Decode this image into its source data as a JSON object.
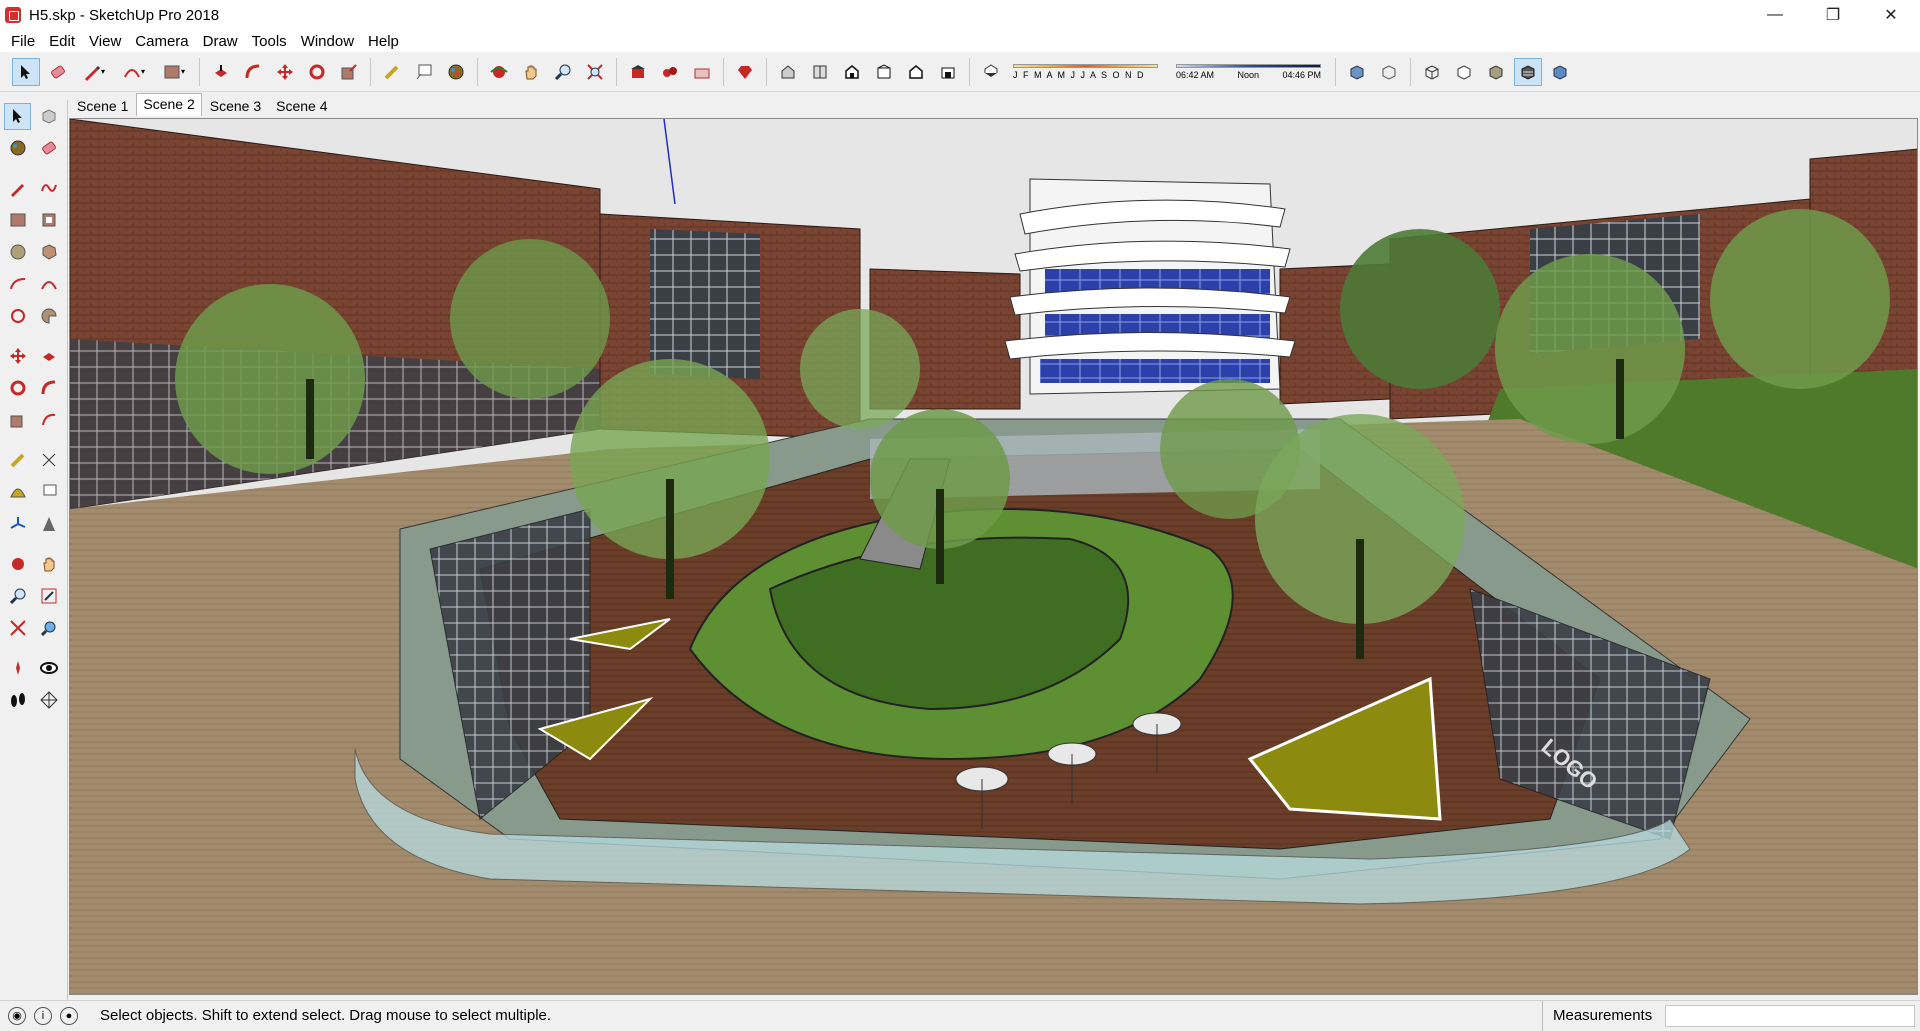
{
  "window": {
    "title": "H5.skp - SketchUp Pro 2018"
  },
  "menu": [
    "File",
    "Edit",
    "View",
    "Camera",
    "Draw",
    "Tools",
    "Window",
    "Help"
  ],
  "shadow_settings": {
    "months_label": "J F M A M J J A S O N D",
    "time_start": "06:42 AM",
    "time_mid": "Noon",
    "time_end": "04:46 PM"
  },
  "scenes": [
    "Scene 1",
    "Scene 2",
    "Scene 3",
    "Scene 4"
  ],
  "active_scene": "Scene 2",
  "viewport": {
    "label_logo": "LOGO"
  },
  "status": {
    "hint": "Select objects. Shift to extend select. Drag mouse to select multiple.",
    "measurements_label": "Measurements",
    "measurements_value": ""
  },
  "colors": {
    "accent": "#cde4f7",
    "sky": "#e6e6e6",
    "deck": "#a08a6c",
    "lawn": "#4f7a2a",
    "brick": "#7a4433",
    "tree": "#6e9a4a"
  }
}
